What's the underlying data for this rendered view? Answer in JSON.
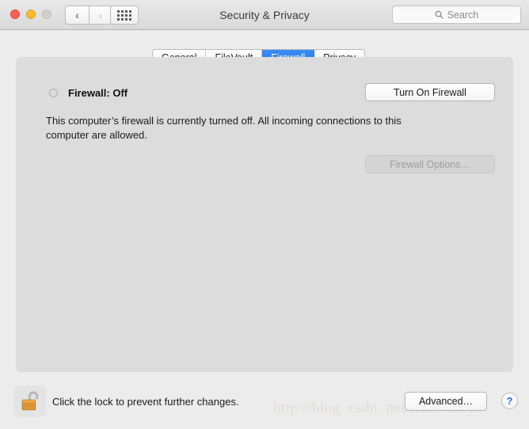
{
  "window": {
    "title": "Security & Privacy",
    "traffic_lights": {
      "close": "close-button",
      "minimize": "minimize-button",
      "zoom": "zoom-button"
    },
    "nav": {
      "back_glyph": "‹",
      "forward_glyph": "›"
    },
    "grid_button": "show-all-preferences"
  },
  "search": {
    "placeholder": "Search",
    "value": ""
  },
  "tabs": [
    {
      "label": "General",
      "active": false
    },
    {
      "label": "FileVault",
      "active": false
    },
    {
      "label": "Firewall",
      "active": true
    },
    {
      "label": "Privacy",
      "active": false
    }
  ],
  "firewall": {
    "status_label": "Firewall: Off",
    "status_state": "off",
    "turn_on_label": "Turn On Firewall",
    "description": "This computer’s firewall is currently turned off. All incoming connections to this computer are allowed.",
    "options_label": "Firewall Options…",
    "options_enabled": false
  },
  "bottom_bar": {
    "lock_state": "unlocked",
    "lock_message": "Click the lock to prevent further changes.",
    "advanced_label": "Advanced…",
    "help_label": "?"
  },
  "watermark": {
    "text": "http://blog. csdn. net/freewebsys"
  },
  "colors": {
    "accent_blue": "#2a7ef0",
    "window_bg": "#ececec",
    "panel_bg": "#dcdcdc",
    "titlebar_bg": "#e2e2e2",
    "close_red": "#ff5f57",
    "minimize_yellow": "#febc2e",
    "zoom_gray": "#cfcfcf",
    "lock_body": "#e08b2c",
    "help_blue": "#2f6fd8"
  }
}
